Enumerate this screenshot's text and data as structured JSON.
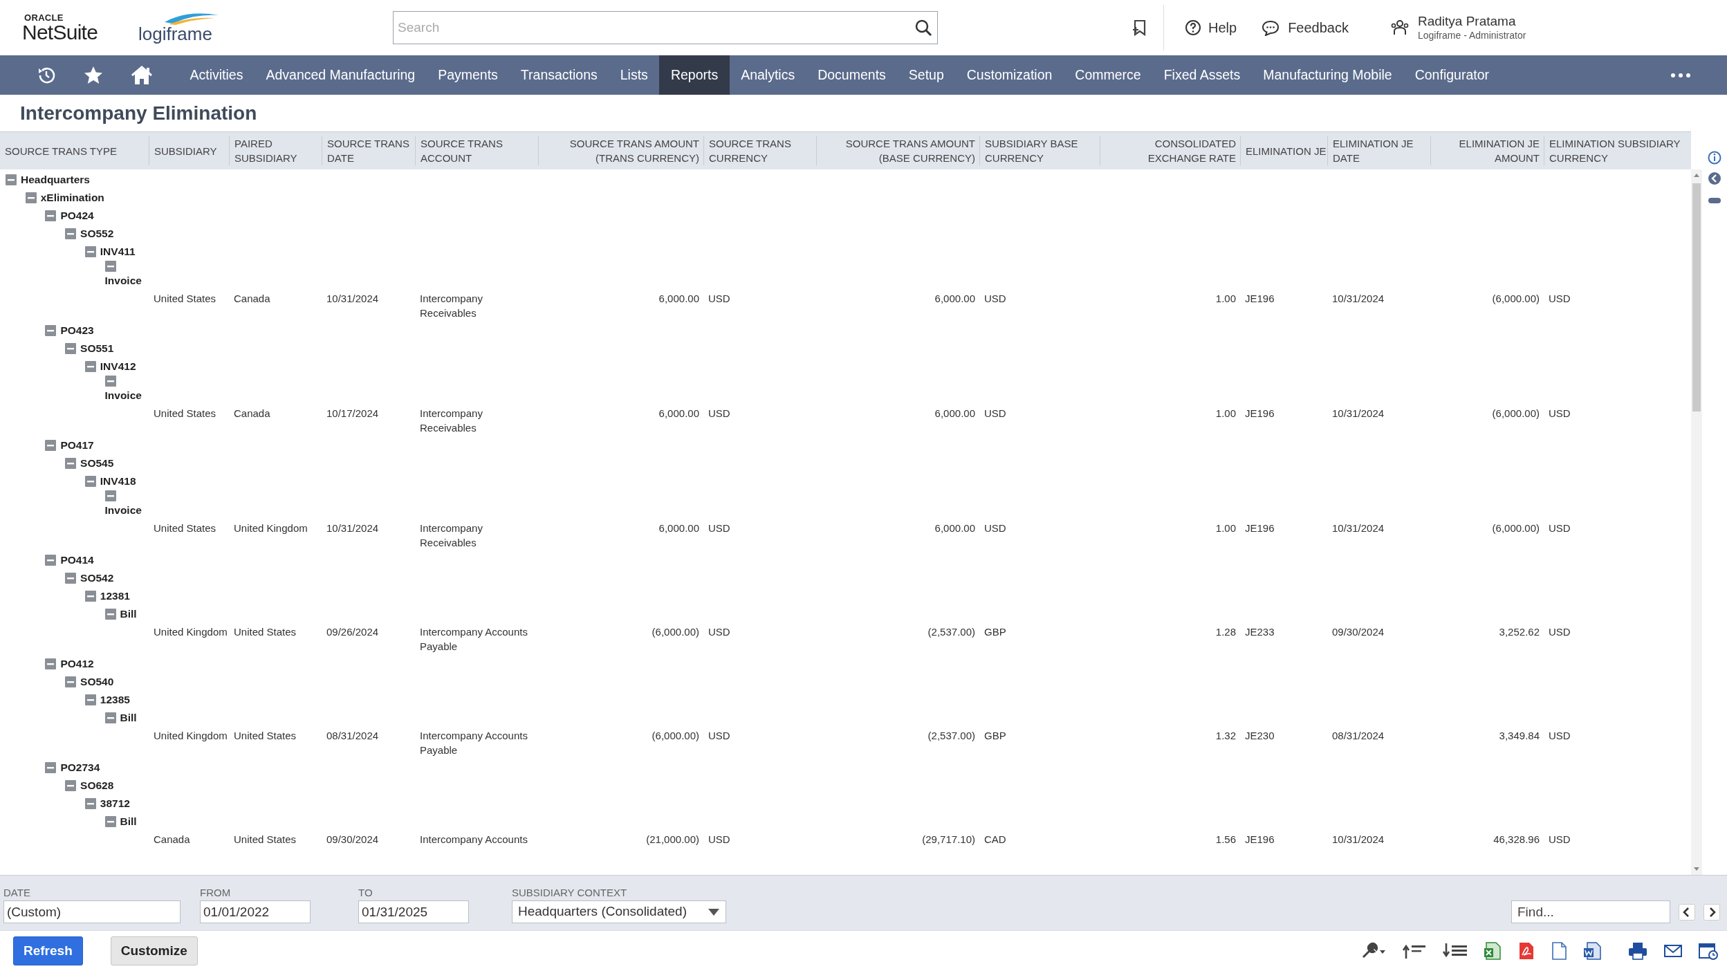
{
  "header": {
    "logo_top": "ORACLE",
    "logo_main": "NetSuite",
    "partner_logo": "logiframe",
    "search": {
      "placeholder": "Search"
    },
    "help": "Help",
    "feedback": "Feedback",
    "user_name": "Raditya Pratama",
    "user_role": "Logiframe - Administrator"
  },
  "nav": [
    {
      "label": "Activities",
      "selected": false
    },
    {
      "label": "Advanced Manufacturing",
      "selected": false
    },
    {
      "label": "Payments",
      "selected": false
    },
    {
      "label": "Transactions",
      "selected": false
    },
    {
      "label": "Lists",
      "selected": false
    },
    {
      "label": "Reports",
      "selected": true
    },
    {
      "label": "Analytics",
      "selected": false
    },
    {
      "label": "Documents",
      "selected": false
    },
    {
      "label": "Setup",
      "selected": false
    },
    {
      "label": "Customization",
      "selected": false
    },
    {
      "label": "Commerce",
      "selected": false
    },
    {
      "label": "Fixed Assets",
      "selected": false
    },
    {
      "label": "Manufacturing Mobile",
      "selected": false
    },
    {
      "label": "Configurator",
      "selected": false
    }
  ],
  "report": {
    "title": "Intercompany Elimination",
    "columns": [
      {
        "label": "SOURCE TRANS TYPE",
        "kind": "text"
      },
      {
        "label": "SUBSIDIARY",
        "kind": "text"
      },
      {
        "label": "PAIRED SUBSIDIARY",
        "kind": "text"
      },
      {
        "label": "SOURCE TRANS DATE",
        "kind": "text"
      },
      {
        "label": "SOURCE TRANS ACCOUNT",
        "kind": "text"
      },
      {
        "label": "SOURCE TRANS AMOUNT (TRANS CURRENCY)",
        "kind": "amount"
      },
      {
        "label": "SOURCE TRANS CURRENCY",
        "kind": "text"
      },
      {
        "label": "SOURCE TRANS AMOUNT (BASE CURRENCY)",
        "kind": "amount"
      },
      {
        "label": "SUBSIDIARY BASE CURRENCY",
        "kind": "text"
      },
      {
        "label": "CONSOLIDATED EXCHANGE RATE",
        "kind": "amount"
      },
      {
        "label": "ELIMINATION JE",
        "kind": "text"
      },
      {
        "label": "ELIMINATION JE DATE",
        "kind": "text"
      },
      {
        "label": "ELIMINATION JE AMOUNT",
        "kind": "amount"
      },
      {
        "label": "ELIMINATION SUBSIDIARY CURRENCY",
        "kind": "text"
      }
    ],
    "tree": [
      {
        "label": "Headquarters",
        "expanded": true,
        "children": [
          {
            "label": "xElimination",
            "expanded": true,
            "children": [
              {
                "label": "PO424",
                "expanded": true,
                "children": [
                  {
                    "label": "SO552",
                    "expanded": true,
                    "children": [
                      {
                        "label": "INV411",
                        "expanded": true,
                        "children": [
                          {
                            "label": "Invoice",
                            "expanded": true,
                            "cells": [
                              "United States",
                              "Canada",
                              "10/31/2024",
                              "Intercompany Receivables",
                              "6,000.00",
                              "USD",
                              "6,000.00",
                              "USD",
                              "1.00",
                              "JE196",
                              "10/31/2024",
                              "(6,000.00)",
                              "USD"
                            ]
                          }
                        ]
                      }
                    ]
                  }
                ]
              },
              {
                "label": "PO423",
                "expanded": true,
                "children": [
                  {
                    "label": "SO551",
                    "expanded": true,
                    "children": [
                      {
                        "label": "INV412",
                        "expanded": true,
                        "children": [
                          {
                            "label": "Invoice",
                            "expanded": true,
                            "cells": [
                              "United States",
                              "Canada",
                              "10/17/2024",
                              "Intercompany Receivables",
                              "6,000.00",
                              "USD",
                              "6,000.00",
                              "USD",
                              "1.00",
                              "JE196",
                              "10/31/2024",
                              "(6,000.00)",
                              "USD"
                            ]
                          }
                        ]
                      }
                    ]
                  }
                ]
              },
              {
                "label": "PO417",
                "expanded": true,
                "children": [
                  {
                    "label": "SO545",
                    "expanded": true,
                    "children": [
                      {
                        "label": "INV418",
                        "expanded": true,
                        "children": [
                          {
                            "label": "Invoice",
                            "expanded": true,
                            "cells": [
                              "United States",
                              "United Kingdom",
                              "10/31/2024",
                              "Intercompany Receivables",
                              "6,000.00",
                              "USD",
                              "6,000.00",
                              "USD",
                              "1.00",
                              "JE196",
                              "10/31/2024",
                              "(6,000.00)",
                              "USD"
                            ]
                          }
                        ]
                      }
                    ]
                  }
                ]
              },
              {
                "label": "PO414",
                "expanded": true,
                "children": [
                  {
                    "label": "SO542",
                    "expanded": true,
                    "children": [
                      {
                        "label": "12381",
                        "expanded": true,
                        "children": [
                          {
                            "label": "Bill",
                            "expanded": true,
                            "cells": [
                              "United Kingdom",
                              "United States",
                              "09/26/2024",
                              "Intercompany Accounts Payable",
                              "(6,000.00)",
                              "USD",
                              "(2,537.00)",
                              "GBP",
                              "1.28",
                              "JE233",
                              "09/30/2024",
                              "3,252.62",
                              "USD"
                            ]
                          }
                        ]
                      }
                    ]
                  }
                ]
              },
              {
                "label": "PO412",
                "expanded": true,
                "children": [
                  {
                    "label": "SO540",
                    "expanded": true,
                    "children": [
                      {
                        "label": "12385",
                        "expanded": true,
                        "children": [
                          {
                            "label": "Bill",
                            "expanded": true,
                            "cells": [
                              "United Kingdom",
                              "United States",
                              "08/31/2024",
                              "Intercompany Accounts Payable",
                              "(6,000.00)",
                              "USD",
                              "(2,537.00)",
                              "GBP",
                              "1.32",
                              "JE230",
                              "08/31/2024",
                              "3,349.84",
                              "USD"
                            ]
                          }
                        ]
                      }
                    ]
                  }
                ]
              },
              {
                "label": "PO2734",
                "expanded": true,
                "children": [
                  {
                    "label": "SO628",
                    "expanded": true,
                    "children": [
                      {
                        "label": "38712",
                        "expanded": true,
                        "children": [
                          {
                            "label": "Bill",
                            "expanded": true,
                            "cells": [
                              "Canada",
                              "United States",
                              "09/30/2024",
                              "Intercompany Accounts",
                              "(21,000.00)",
                              "USD",
                              "(29,717.10)",
                              "CAD",
                              "1.56",
                              "JE196",
                              "10/31/2024",
                              "46,328.96",
                              "USD"
                            ]
                          }
                        ]
                      }
                    ]
                  }
                ]
              }
            ]
          }
        ]
      }
    ]
  },
  "filters": [
    {
      "label": "DATE",
      "value": "(Custom)",
      "kind": "text"
    },
    {
      "label": "FROM",
      "value": "01/01/2022",
      "kind": "text"
    },
    {
      "label": "TO",
      "value": "01/31/2025",
      "kind": "text"
    },
    {
      "label": "SUBSIDIARY CONTEXT",
      "value": "Headquarters (Consolidated)",
      "kind": "select"
    }
  ],
  "find": {
    "placeholder": "Find..."
  },
  "buttons": [
    {
      "label": "Refresh",
      "kind": "primary"
    },
    {
      "label": "Customize",
      "kind": "secondary"
    }
  ]
}
